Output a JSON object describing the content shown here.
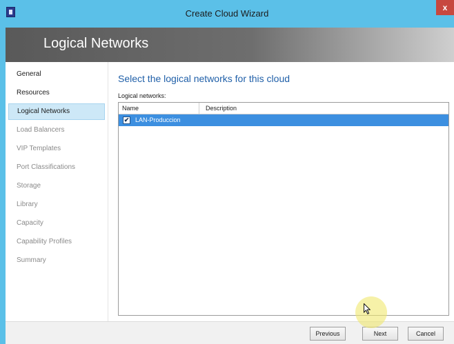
{
  "window": {
    "title": "Create Cloud Wizard",
    "close_glyph": "x",
    "app_icon": "wizard-app-icon"
  },
  "banner": {
    "title": "Logical Networks"
  },
  "sidebar": {
    "items": [
      {
        "label": "General",
        "state": "normal"
      },
      {
        "label": "Resources",
        "state": "normal"
      },
      {
        "label": "Logical Networks",
        "state": "active"
      },
      {
        "label": "Load Balancers",
        "state": "dim"
      },
      {
        "label": "VIP Templates",
        "state": "dim"
      },
      {
        "label": "Port Classifications",
        "state": "dim"
      },
      {
        "label": "Storage",
        "state": "dim"
      },
      {
        "label": "Library",
        "state": "dim"
      },
      {
        "label": "Capacity",
        "state": "dim"
      },
      {
        "label": "Capability Profiles",
        "state": "dim"
      },
      {
        "label": "Summary",
        "state": "dim"
      }
    ]
  },
  "main": {
    "heading": "Select the logical networks for this cloud",
    "list_label": "Logical networks:",
    "columns": {
      "name": "Name",
      "description": "Description"
    },
    "rows": [
      {
        "name": "LAN-Produccion",
        "description": "",
        "checked": true,
        "check_glyph": "✔"
      }
    ]
  },
  "footer": {
    "previous": "Previous",
    "next": "Next",
    "cancel": "Cancel"
  },
  "colors": {
    "title_bar": "#5bc0e8",
    "heading": "#1f5fa8",
    "selection": "#3c8fe0",
    "active_nav": "#cde8f7"
  }
}
